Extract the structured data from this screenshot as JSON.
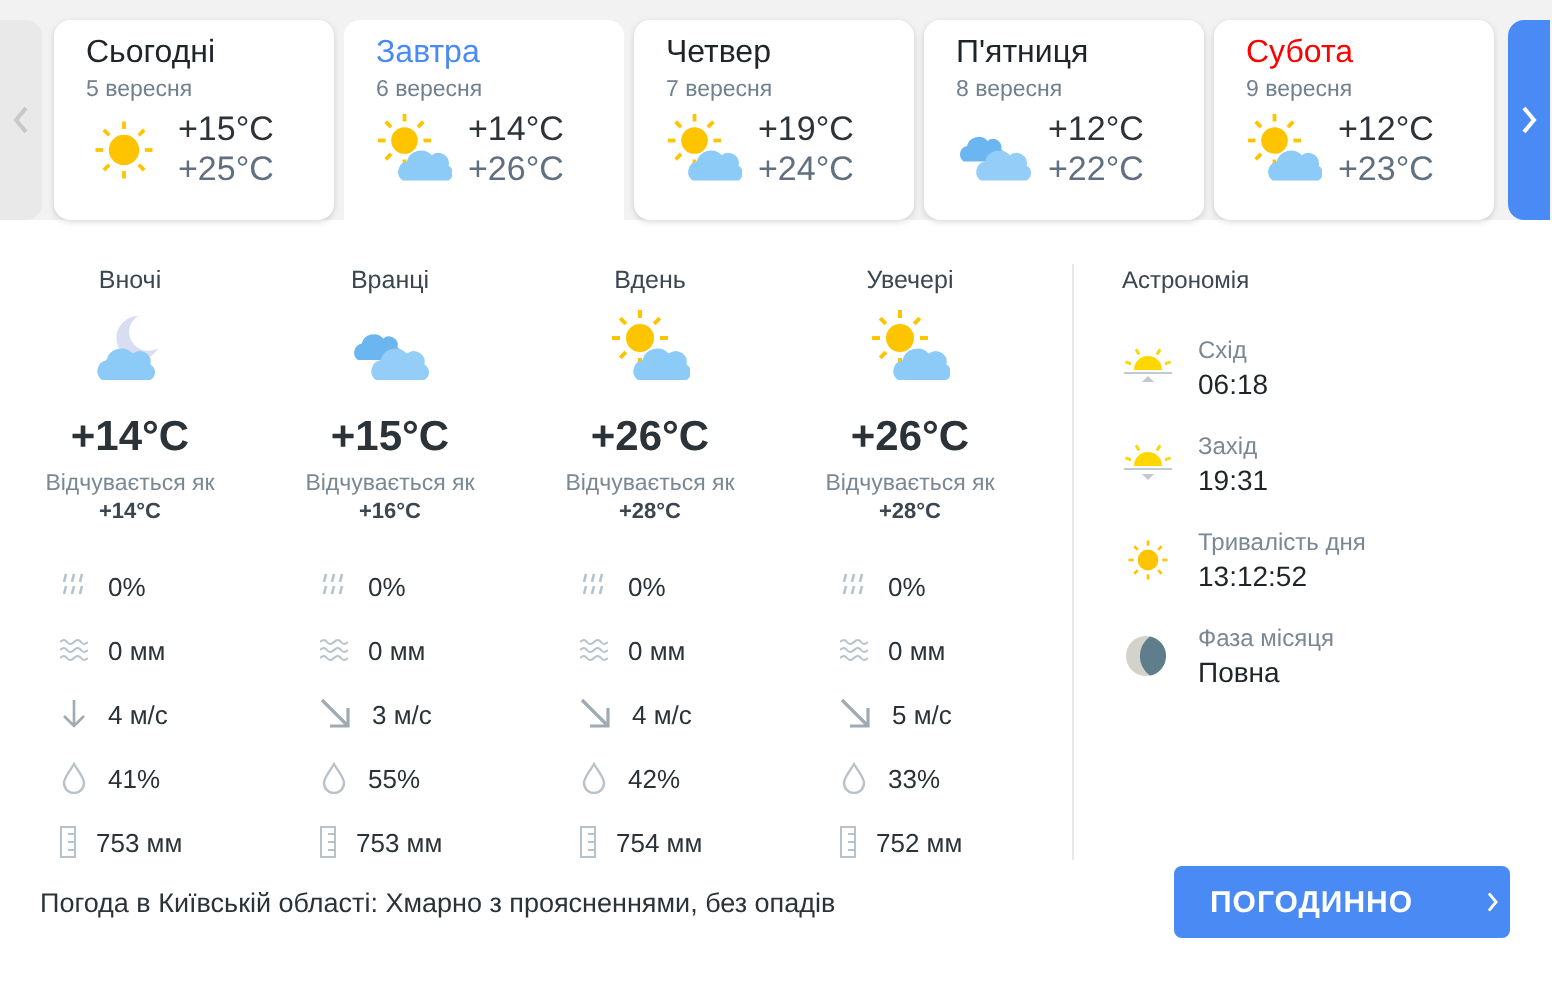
{
  "days": [
    {
      "name": "Сьогодні",
      "date": "5 вересня",
      "kind": "sun",
      "min": "+15°C",
      "max": "+25°C",
      "selected": false,
      "color": "#1f2428"
    },
    {
      "name": "Завтра",
      "date": "6 вересня",
      "kind": "sun-cloud",
      "min": "+14°C",
      "max": "+26°C",
      "selected": true,
      "color": "#4a8af4"
    },
    {
      "name": "Четвер",
      "date": "7 вересня",
      "kind": "sun-cloud",
      "min": "+19°C",
      "max": "+24°C",
      "selected": false,
      "color": "#1f2428"
    },
    {
      "name": "П'ятниця",
      "date": "8 вересня",
      "kind": "clouds",
      "min": "+12°C",
      "max": "+22°C",
      "selected": false,
      "color": "#1f2428"
    },
    {
      "name": "Субота",
      "date": "9 вересня",
      "kind": "sun-cloud",
      "min": "+12°C",
      "max": "+23°C",
      "selected": false,
      "color": "#ff0000"
    }
  ],
  "periods": [
    {
      "label": "Вночі",
      "kind": "moon-cloud",
      "temp": "+14°C",
      "feels_label": "Відчувається як",
      "feels": "+14°C",
      "precip_chance": "0%",
      "precip": "0 мм",
      "wind": {
        "kind": "down",
        "text": "4 м/с"
      },
      "humidity": "41%",
      "pressure": "753 мм"
    },
    {
      "label": "Вранці",
      "kind": "clouds",
      "temp": "+15°C",
      "feels_label": "Відчувається як",
      "feels": "+16°C",
      "precip_chance": "0%",
      "precip": "0 мм",
      "wind": {
        "kind": "down-right",
        "text": "3 м/с"
      },
      "humidity": "55%",
      "pressure": "753 мм"
    },
    {
      "label": "Вдень",
      "kind": "sun-cloud",
      "temp": "+26°C",
      "feels_label": "Відчувається як",
      "feels": "+28°C",
      "precip_chance": "0%",
      "precip": "0 мм",
      "wind": {
        "kind": "down-right",
        "text": "4 м/с"
      },
      "humidity": "42%",
      "pressure": "754 мм"
    },
    {
      "label": "Увечері",
      "kind": "sun-cloud",
      "temp": "+26°C",
      "feels_label": "Відчувається як",
      "feels": "+28°C",
      "precip_chance": "0%",
      "precip": "0 мм",
      "wind": {
        "kind": "down-right",
        "text": "5 м/с"
      },
      "humidity": "33%",
      "pressure": "752 мм"
    }
  ],
  "astronomy": {
    "title": "Астрономія",
    "items": [
      {
        "kind": "sunrise",
        "label": "Схід",
        "value": "06:18"
      },
      {
        "kind": "sunset",
        "label": "Захід",
        "value": "19:31"
      },
      {
        "kind": "daylength",
        "label": "Тривалість дня",
        "value": "13:12:52"
      },
      {
        "kind": "moon",
        "label": "Фаза місяця",
        "value": "Повна"
      }
    ]
  },
  "summary": "Погода в Київській області: Хмарно з проясненнями, без опадів",
  "hourly_button": "ПОГОДИННО"
}
